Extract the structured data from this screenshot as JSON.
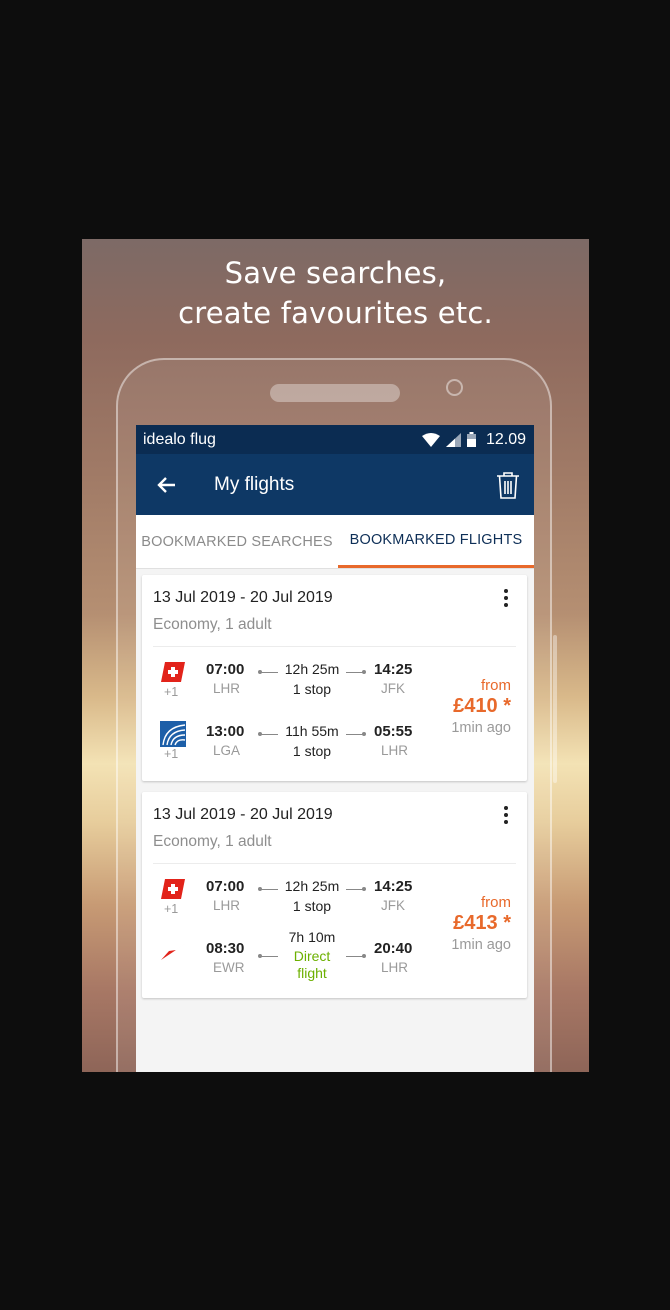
{
  "promo": {
    "headline_line1": "Save searches,",
    "headline_line2": "create favourites etc."
  },
  "status_bar": {
    "app_name": "idealo flug",
    "time": "12.09",
    "icons": [
      "wifi-icon",
      "signal-icon",
      "battery-icon"
    ]
  },
  "app_bar": {
    "back_icon": "arrow-left-icon",
    "title": "My flights",
    "delete_icon": "trash-icon"
  },
  "tabs": [
    {
      "label": "BOOKMARKED SEARCHES",
      "active": false
    },
    {
      "label": "BOOKMARKED FLIGHTS",
      "active": true
    }
  ],
  "colors": {
    "primary": "#0e3865",
    "status_bar": "#0b2c52",
    "accent": "#e8692b",
    "direct": "#6cb000"
  },
  "flights": [
    {
      "dates": "13 Jul 2019 - 20 Jul 2019",
      "meta": "Economy, 1 adult",
      "legs": [
        {
          "airline_icon": "swiss-logo-icon",
          "extra": "+1",
          "dep_time": "07:00",
          "dep_airport": "LHR",
          "duration": "12h 25m",
          "stops": "1 stop",
          "arr_time": "14:25",
          "arr_airport": "JFK"
        },
        {
          "airline_icon": "united-logo-icon",
          "extra": "+1",
          "dep_time": "13:00",
          "dep_airport": "LGA",
          "duration": "11h 55m",
          "stops": "1 stop",
          "arr_time": "05:55",
          "arr_airport": "LHR"
        }
      ],
      "from_label": "from",
      "price": "£410 *",
      "updated": "1min ago"
    },
    {
      "dates": "13 Jul 2019 - 20 Jul 2019",
      "meta": "Economy, 1 adult",
      "legs": [
        {
          "airline_icon": "swiss-logo-icon",
          "extra": "+1",
          "dep_time": "07:00",
          "dep_airport": "LHR",
          "duration": "12h 25m",
          "stops": "1 stop",
          "arr_time": "14:25",
          "arr_airport": "JFK"
        },
        {
          "airline_icon": "austrian-logo-icon",
          "extra": "",
          "dep_time": "08:30",
          "dep_airport": "EWR",
          "duration": "7h 10m",
          "stops_line1": "Direct",
          "stops_line2": "flight",
          "arr_time": "20:40",
          "arr_airport": "LHR"
        }
      ],
      "from_label": "from",
      "price": "£413 *",
      "updated": "1min ago"
    }
  ]
}
